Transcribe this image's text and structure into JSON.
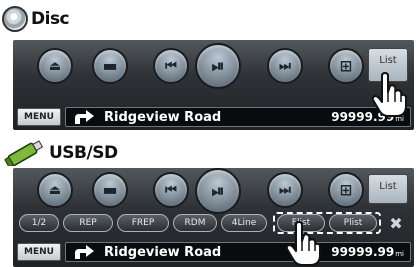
{
  "sections": [
    {
      "title": "Disc",
      "icon": "disc-icon",
      "controls": [
        "eject-icon",
        "folder-up-icon",
        "previous-track-icon",
        "play-pause-icon",
        "next-track-icon",
        "folder-down-icon"
      ],
      "list_label": "List",
      "menu_label": "MENU",
      "road_name": "Ridgeview Road",
      "distance": "99999.99",
      "distance_unit": "mi"
    },
    {
      "title": "USB/SD",
      "icon": "usb-drive-icon",
      "controls": [
        "eject-icon",
        "folder-up-icon",
        "previous-track-icon",
        "play-pause-icon",
        "next-track-icon",
        "folder-down-icon"
      ],
      "list_label": "List",
      "function_buttons": [
        "1/2",
        "REP",
        "FREP",
        "RDM",
        "4Line",
        "Flist",
        "Plist"
      ],
      "close_glyph": "✖",
      "menu_label": "MENU",
      "road_name": "Ridgeview Road",
      "distance": "99999.99",
      "distance_unit": "mi"
    }
  ],
  "colors": {
    "panel": "#2e3236",
    "button": "#8a97a3",
    "road_box": "#0a0b0c",
    "highlight_dash": "#ffffff"
  }
}
